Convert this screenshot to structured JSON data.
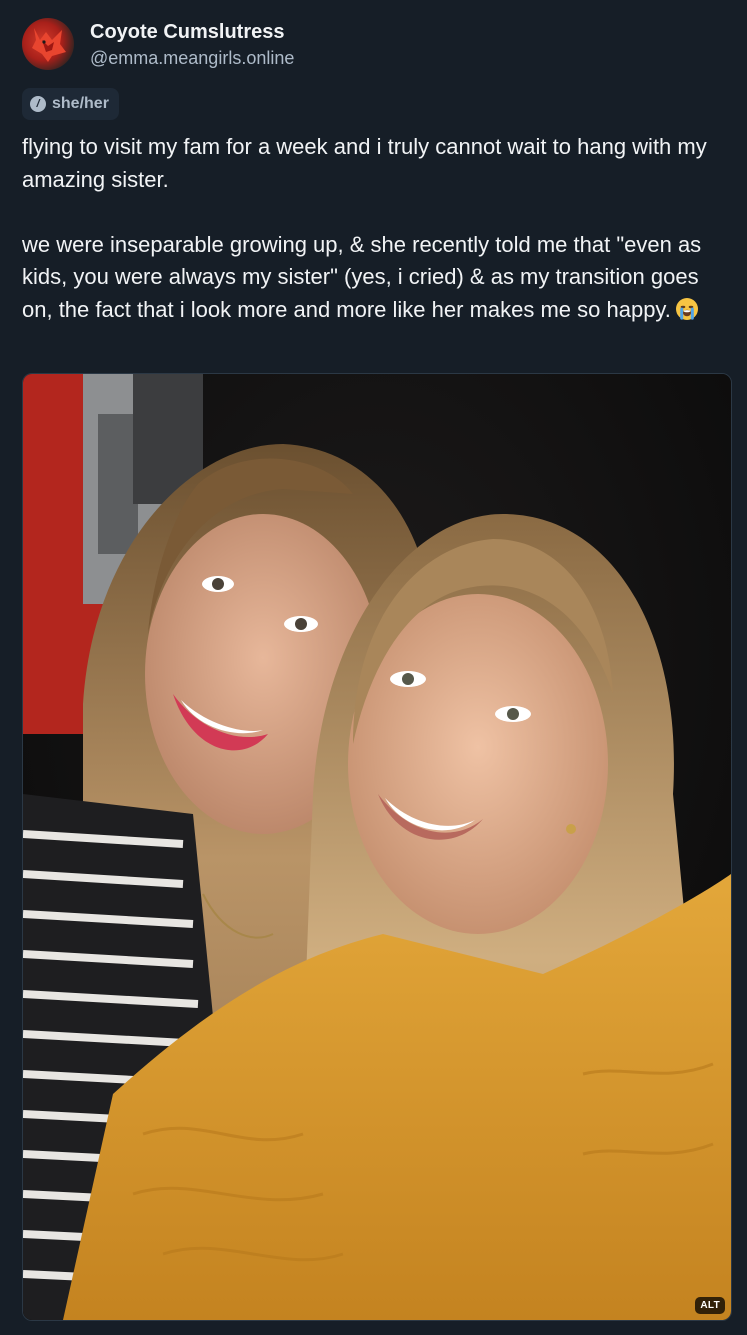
{
  "author": {
    "display_name": "Coyote Cumslutress",
    "handle": "@emma.meangirls.online",
    "avatar_icon": "coyote-avatar",
    "pronouns": "she/her",
    "pronoun_icon_glyph": "/"
  },
  "post": {
    "text": "flying to visit my fam for a week and i truly cannot wait to hang with my amazing sister.\n\nwe were inseparable growing up, & she recently told me that \"even as kids, you were always my sister\" (yes, i cried) & as my transition goes on, the fact that i look more and more like her makes me so happy.",
    "emoji": "loudly-crying-face"
  },
  "media": {
    "alt_label": "ALT"
  },
  "colors": {
    "background": "#161e27",
    "text_primary": "#f1f3f5",
    "text_secondary": "#aebbc9",
    "chip_bg": "#1e2936"
  }
}
